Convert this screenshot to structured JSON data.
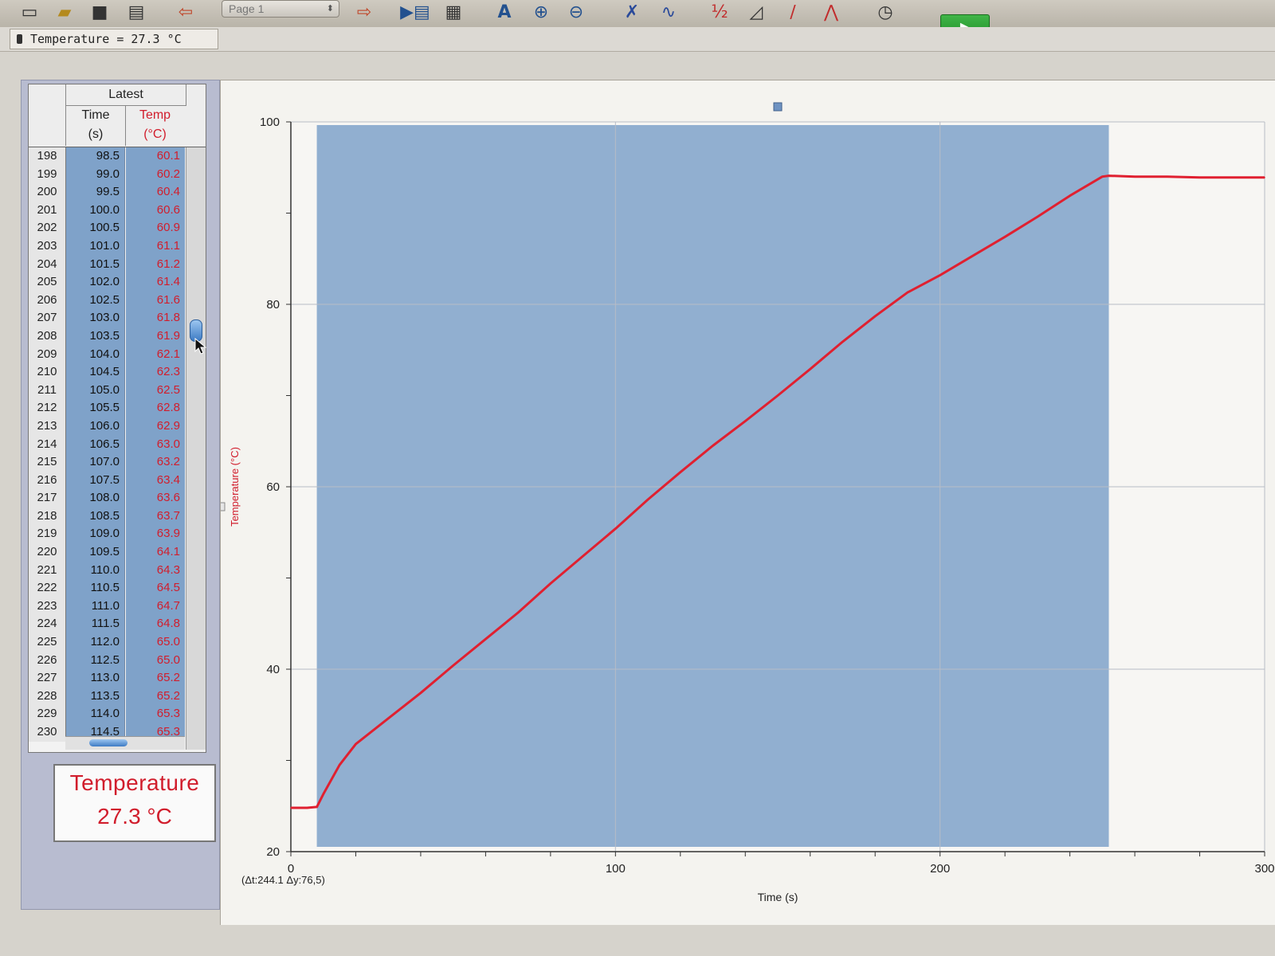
{
  "toolbar": {
    "page_select_value": "Page 1",
    "icons": [
      "new-file-icon",
      "open-folder-icon",
      "save-icon",
      "print-icon",
      "undo-icon",
      "page-select",
      "next-page-icon",
      "data-browser-icon",
      "calculator-icon",
      "autoscale-icon",
      "zoom-in-icon",
      "zoom-out-icon",
      "examine-icon",
      "interpolate-icon",
      "integral-icon",
      "tangent-icon",
      "linear-fit-icon",
      "curve-fit-icon",
      "timer-icon",
      "collect-button"
    ]
  },
  "status": {
    "readout": "Temperature = 27.3 °C"
  },
  "table": {
    "group_header": "Latest",
    "time_header_l1": "Time",
    "time_header_l2": "(s)",
    "temp_header_l1": "Temp",
    "temp_header_l2": "(°C)",
    "rows": [
      [
        "198",
        "98.5",
        "60.1"
      ],
      [
        "199",
        "99.0",
        "60.2"
      ],
      [
        "200",
        "99.5",
        "60.4"
      ],
      [
        "201",
        "100.0",
        "60.6"
      ],
      [
        "202",
        "100.5",
        "60.9"
      ],
      [
        "203",
        "101.0",
        "61.1"
      ],
      [
        "204",
        "101.5",
        "61.2"
      ],
      [
        "205",
        "102.0",
        "61.4"
      ],
      [
        "206",
        "102.5",
        "61.6"
      ],
      [
        "207",
        "103.0",
        "61.8"
      ],
      [
        "208",
        "103.5",
        "61.9"
      ],
      [
        "209",
        "104.0",
        "62.1"
      ],
      [
        "210",
        "104.5",
        "62.3"
      ],
      [
        "211",
        "105.0",
        "62.5"
      ],
      [
        "212",
        "105.5",
        "62.8"
      ],
      [
        "213",
        "106.0",
        "62.9"
      ],
      [
        "214",
        "106.5",
        "63.0"
      ],
      [
        "215",
        "107.0",
        "63.2"
      ],
      [
        "216",
        "107.5",
        "63.4"
      ],
      [
        "217",
        "108.0",
        "63.6"
      ],
      [
        "218",
        "108.5",
        "63.7"
      ],
      [
        "219",
        "109.0",
        "63.9"
      ],
      [
        "220",
        "109.5",
        "64.1"
      ],
      [
        "221",
        "110.0",
        "64.3"
      ],
      [
        "222",
        "110.5",
        "64.5"
      ],
      [
        "223",
        "111.0",
        "64.7"
      ],
      [
        "224",
        "111.5",
        "64.8"
      ],
      [
        "225",
        "112.0",
        "65.0"
      ],
      [
        "226",
        "112.5",
        "65.0"
      ],
      [
        "227",
        "113.0",
        "65.2"
      ],
      [
        "228",
        "113.5",
        "65.2"
      ],
      [
        "229",
        "114.0",
        "65.3"
      ],
      [
        "230",
        "114.5",
        "65.3"
      ]
    ]
  },
  "meter": {
    "label": "Temperature",
    "value": "27.3 °C"
  },
  "chart_data": {
    "type": "line",
    "xlabel": "Time (s)",
    "ylabel": "Temperature (°C)",
    "xlim": [
      0,
      300
    ],
    "ylim": [
      20,
      100
    ],
    "x_ticks": [
      "0",
      "100",
      "200",
      "300"
    ],
    "y_ticks": [
      "20",
      "40",
      "60",
      "80",
      "100"
    ],
    "grid": true,
    "series_color": "#e02030",
    "selection_color": "#7fa2c9",
    "selection_range": [
      8,
      252
    ],
    "annotation": "(Δt:244.1 Δy:76,5)",
    "series": [
      {
        "x": [
          0,
          5,
          8,
          10,
          15,
          20,
          30,
          40,
          50,
          60,
          70,
          80,
          90,
          100,
          110,
          120,
          130,
          140,
          150,
          160,
          170,
          180,
          190,
          200,
          210,
          220,
          230,
          240,
          250,
          252,
          260,
          270,
          280,
          290,
          300
        ],
        "y": [
          24.8,
          24.8,
          24.9,
          26.3,
          29.5,
          31.8,
          34.6,
          37.4,
          40.4,
          43.3,
          46.2,
          49.4,
          52.4,
          55.4,
          58.6,
          61.6,
          64.5,
          67.2,
          70.0,
          72.9,
          75.9,
          78.7,
          81.3,
          83.2,
          85.3,
          87.4,
          89.6,
          91.9,
          94.0,
          94.1,
          94.0,
          94.0,
          93.9,
          93.9,
          93.9
        ]
      }
    ]
  }
}
